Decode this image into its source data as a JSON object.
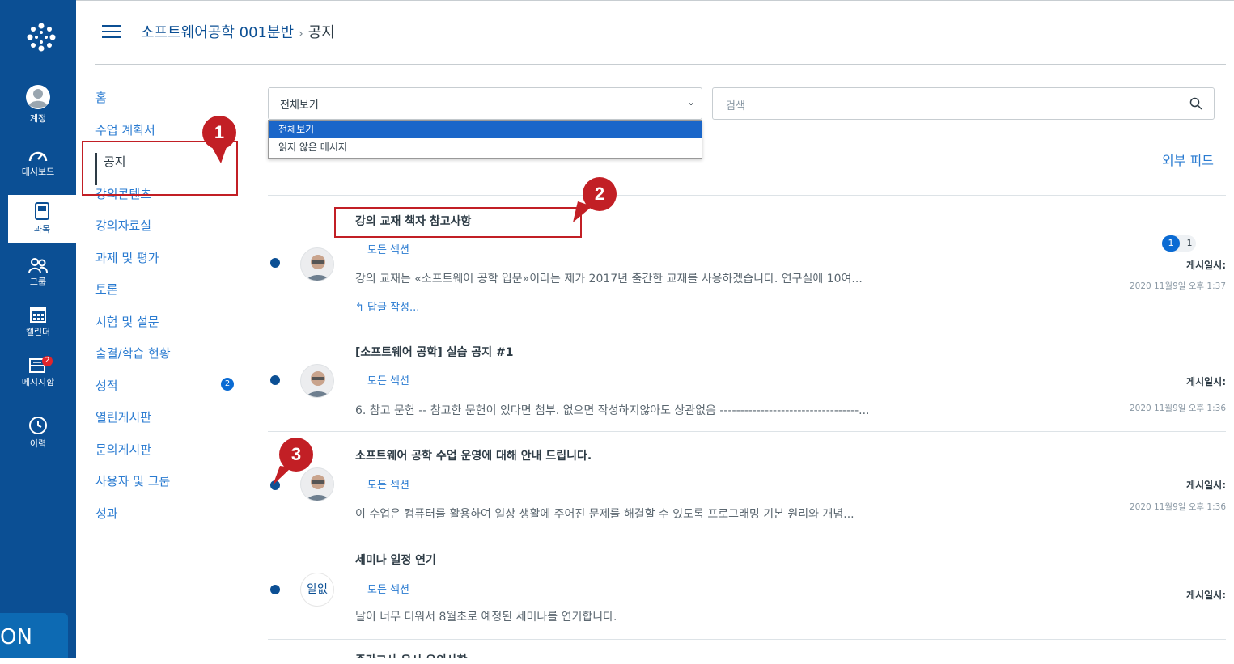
{
  "rail": {
    "account": "계정",
    "dashboard": "대시보드",
    "courses": "과목",
    "groups": "그룹",
    "calendar": "캘린더",
    "inbox": "메시지함",
    "inbox_badge": "2",
    "history": "이력",
    "footer_tag": "ON"
  },
  "header": {
    "course": "소프트웨어공학 001분반",
    "separator": "›",
    "page": "공지"
  },
  "course_nav": {
    "items": [
      {
        "label": "홈"
      },
      {
        "label": "수업 계획서"
      },
      {
        "label": "공지"
      },
      {
        "label": "강의콘텐츠"
      },
      {
        "label": "강의자료실"
      },
      {
        "label": "과제 및 평가"
      },
      {
        "label": "토론"
      },
      {
        "label": "시험 및 설문"
      },
      {
        "label": "출결/학습 현황"
      },
      {
        "label": "성적",
        "badge": "2"
      },
      {
        "label": "열린게시판"
      },
      {
        "label": "문의게시판"
      },
      {
        "label": "사용자 및 그룹"
      },
      {
        "label": "성과"
      }
    ]
  },
  "filter": {
    "selected": "전체보기",
    "options": [
      "전체보기",
      "읽지 않은 메시지"
    ]
  },
  "search": {
    "placeholder": "검색"
  },
  "external_feed": "외부 피드",
  "announcements": [
    {
      "title": "강의 교재 책자 참고사항",
      "section": "모든 섹션",
      "body": "강의 교재는 «소프트웨어 공학 입문»이라는 제가 2017년 출간한 교재를 사용하겠습니다. 연구실에 10여...",
      "reply": "답글 작성...",
      "posted_label": "게시일시:",
      "posted_date": "2020 11월9일 오후 1:37",
      "count_unread": "1",
      "count_total": "1"
    },
    {
      "title": "[소프트웨어 공학] 실습 공지 #1",
      "section": "모든 섹션",
      "body": "6. 참고 문헌 -- 참고한 문헌이 있다면 첨부. 없으면 작성하지않아도 상관없음 ----------------------------------...",
      "posted_label": "게시일시:",
      "posted_date": "2020 11월9일 오후 1:36"
    },
    {
      "title": "소프트웨어 공학 수업 운영에 대해 안내 드립니다.",
      "section": "모든 섹션",
      "body": "이 수업은 컴퓨터를 활용하여 일상 생활에 주어진 문제를 해결할 수 있도록 프로그래밍 기본 원리와 개념...",
      "posted_label": "게시일시:",
      "posted_date": "2020 11월9일 오후 1:36"
    },
    {
      "title": "세미나 일정 연기",
      "section": "모든 섹션",
      "avatar_text": "알없",
      "body": "날이 너무 더워서 8월초로 예정된 세미나를 연기합니다.",
      "posted_label": "게시일시:"
    },
    {
      "title": "중간고사 응시 유의사항"
    }
  ],
  "callouts": [
    "1",
    "2",
    "3"
  ],
  "colors": {
    "rail": "#0b4f94",
    "link": "#2a7bd1",
    "callout": "#c21f25",
    "selected_option": "#1a66c9"
  }
}
